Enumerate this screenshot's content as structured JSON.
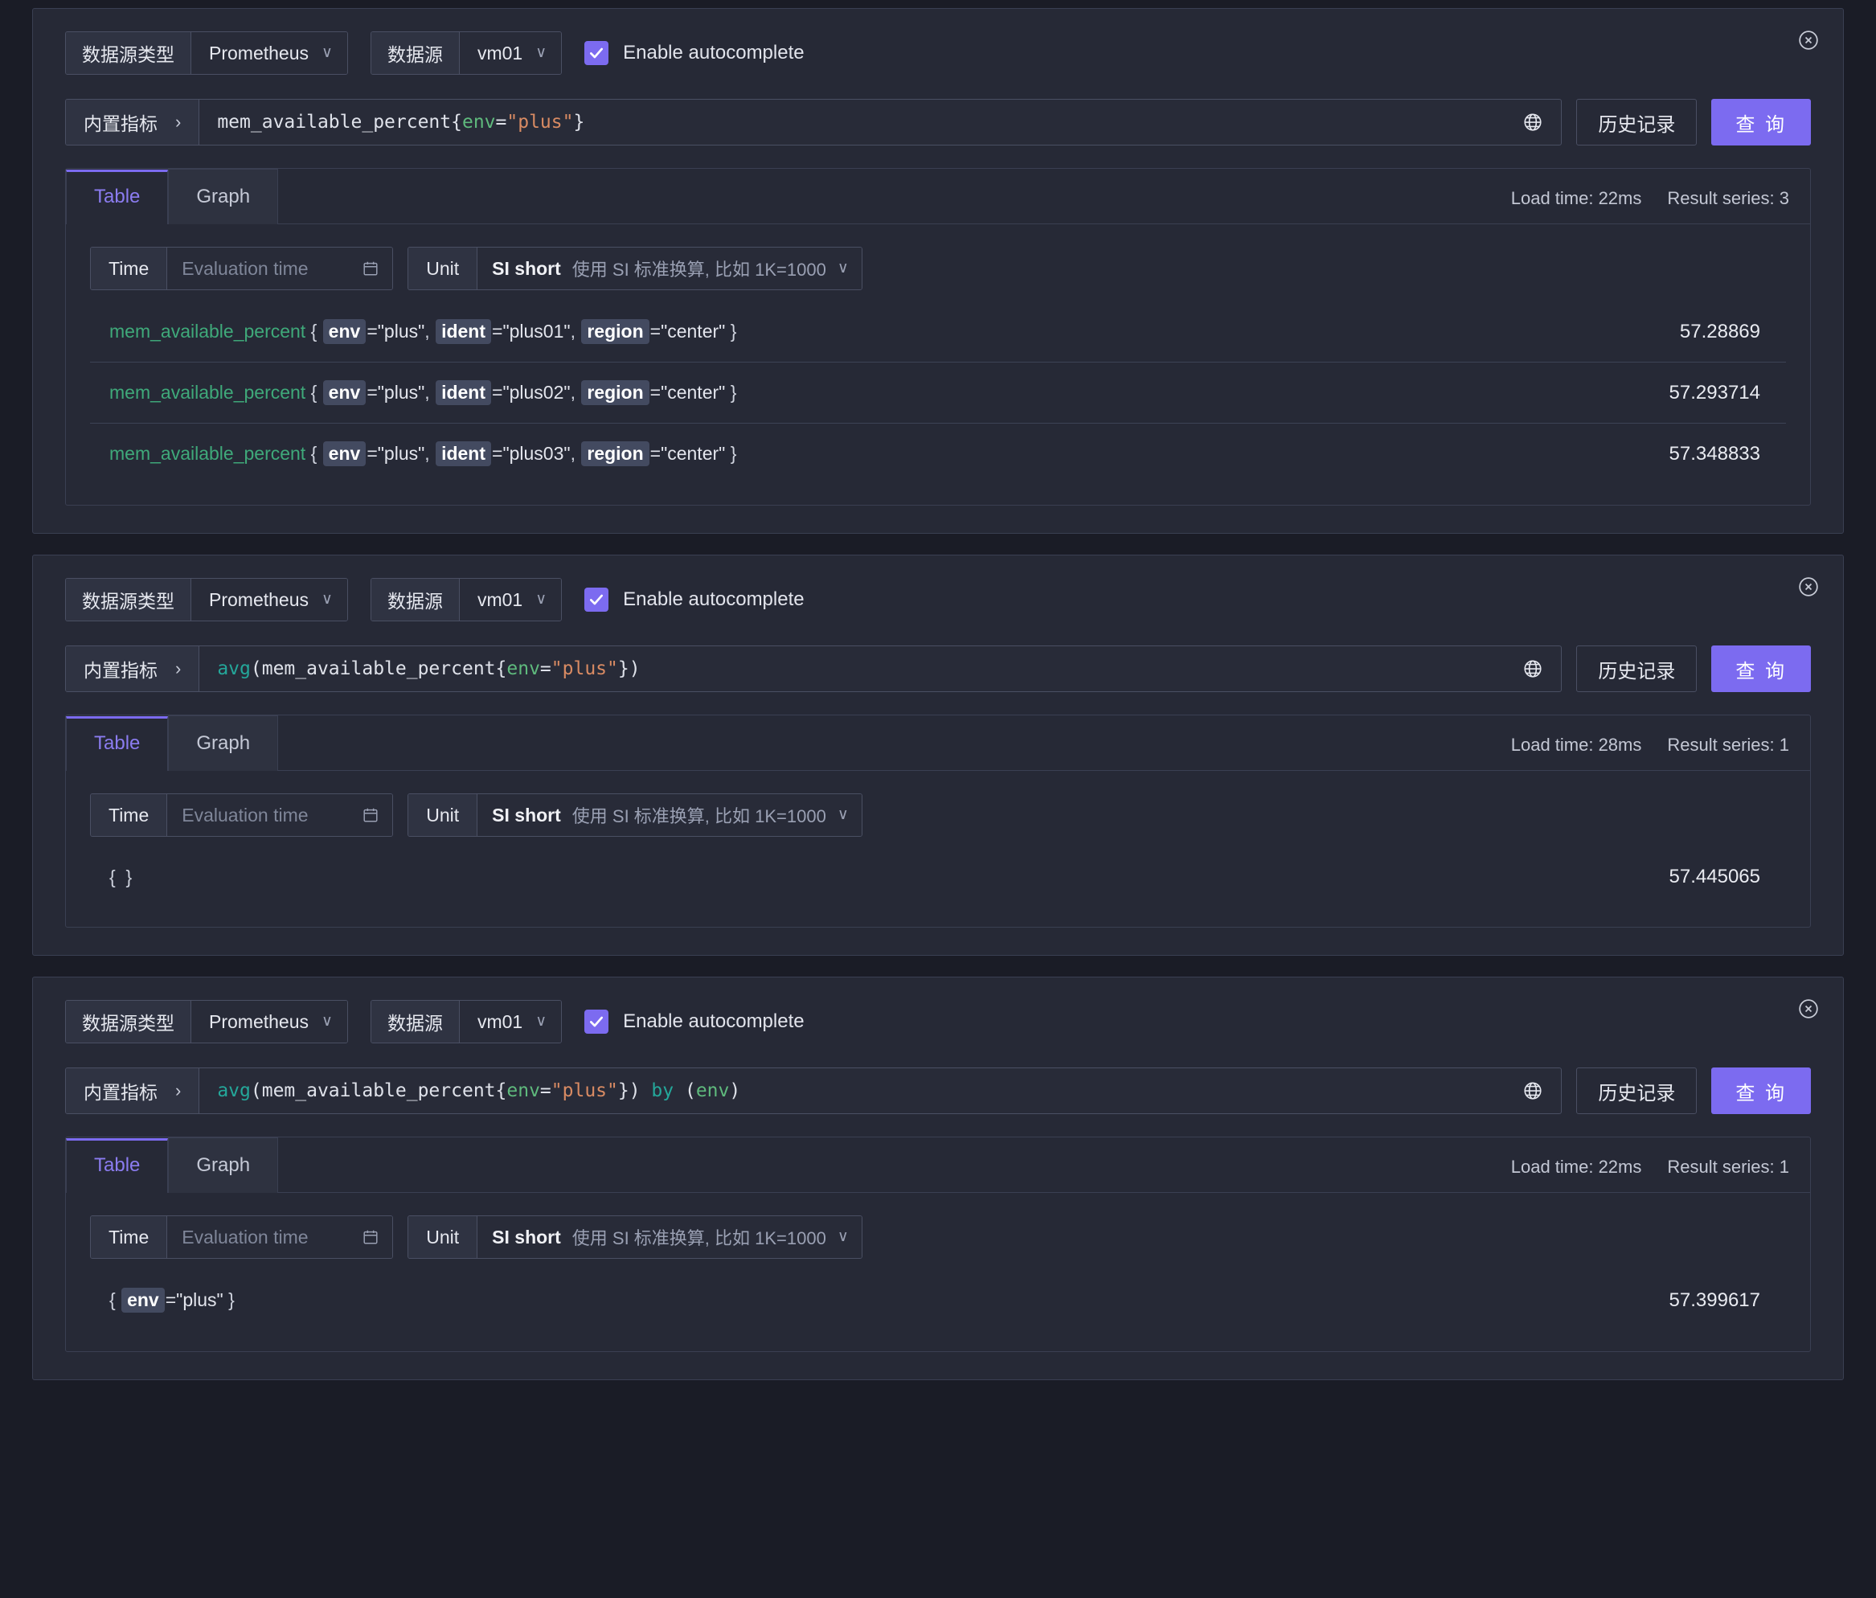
{
  "panels": [
    {
      "close_icon": "close-circle-icon",
      "datasource": {
        "type_label": "数据源类型",
        "type_value": "Prometheus",
        "ds_label": "数据源",
        "ds_value": "vm01",
        "autocomplete_label": "Enable autocomplete",
        "autocomplete_checked": true
      },
      "query": {
        "prefix_label": "内置指标",
        "prefix_chevron": "›",
        "globe_icon": "globe-icon",
        "history_label": "历史记录",
        "run_label": "查 询",
        "expression_tokens": [
          {
            "t": "plain",
            "v": "mem_available_percent{"
          },
          {
            "t": "label",
            "v": "env"
          },
          {
            "t": "plain",
            "v": "="
          },
          {
            "t": "str",
            "v": "\"plus\""
          },
          {
            "t": "plain",
            "v": "}"
          }
        ]
      },
      "tabs": [
        {
          "label": "Table",
          "active": true
        },
        {
          "label": "Graph",
          "active": false
        }
      ],
      "meta": {
        "load_time": "Load time: 22ms",
        "result_series": "Result series: 3"
      },
      "controls": {
        "time_label": "Time",
        "time_placeholder": "Evaluation time",
        "calendar_icon": "calendar-icon",
        "unit_label": "Unit",
        "unit_value": "SI short",
        "unit_desc": "使用 SI 标准换算, 比如 1K=1000",
        "unit_caret": "chevron-down-icon"
      },
      "rows": [
        {
          "metric": "mem_available_percent",
          "labels": [
            {
              "key": "env",
              "value": "\"plus\""
            },
            {
              "key": "ident",
              "value": "\"plus01\""
            },
            {
              "key": "region",
              "value": "\"center\""
            }
          ],
          "value": "57.28869"
        },
        {
          "metric": "mem_available_percent",
          "labels": [
            {
              "key": "env",
              "value": "\"plus\""
            },
            {
              "key": "ident",
              "value": "\"plus02\""
            },
            {
              "key": "region",
              "value": "\"center\""
            }
          ],
          "value": "57.293714"
        },
        {
          "metric": "mem_available_percent",
          "labels": [
            {
              "key": "env",
              "value": "\"plus\""
            },
            {
              "key": "ident",
              "value": "\"plus03\""
            },
            {
              "key": "region",
              "value": "\"center\""
            }
          ],
          "value": "57.348833"
        }
      ]
    },
    {
      "close_icon": "close-circle-icon",
      "datasource": {
        "type_label": "数据源类型",
        "type_value": "Prometheus",
        "ds_label": "数据源",
        "ds_value": "vm01",
        "autocomplete_label": "Enable autocomplete",
        "autocomplete_checked": true
      },
      "query": {
        "prefix_label": "内置指标",
        "prefix_chevron": "›",
        "globe_icon": "globe-icon",
        "history_label": "历史记录",
        "run_label": "查 询",
        "expression_tokens": [
          {
            "t": "fn",
            "v": "avg"
          },
          {
            "t": "plain",
            "v": "(mem_available_percent{"
          },
          {
            "t": "label",
            "v": "env"
          },
          {
            "t": "plain",
            "v": "="
          },
          {
            "t": "str",
            "v": "\"plus\""
          },
          {
            "t": "plain",
            "v": "})"
          }
        ]
      },
      "tabs": [
        {
          "label": "Table",
          "active": true
        },
        {
          "label": "Graph",
          "active": false
        }
      ],
      "meta": {
        "load_time": "Load time: 28ms",
        "result_series": "Result series: 1"
      },
      "controls": {
        "time_label": "Time",
        "time_placeholder": "Evaluation time",
        "calendar_icon": "calendar-icon",
        "unit_label": "Unit",
        "unit_value": "SI short",
        "unit_desc": "使用 SI 标准换算, 比如 1K=1000",
        "unit_caret": "chevron-down-icon"
      },
      "rows": [
        {
          "metric": "",
          "labels": [],
          "value": "57.445065"
        }
      ]
    },
    {
      "close_icon": "close-circle-icon",
      "datasource": {
        "type_label": "数据源类型",
        "type_value": "Prometheus",
        "ds_label": "数据源",
        "ds_value": "vm01",
        "autocomplete_label": "Enable autocomplete",
        "autocomplete_checked": true
      },
      "query": {
        "prefix_label": "内置指标",
        "prefix_chevron": "›",
        "globe_icon": "globe-icon",
        "history_label": "历史记录",
        "run_label": "查 询",
        "expression_tokens": [
          {
            "t": "fn",
            "v": "avg"
          },
          {
            "t": "plain",
            "v": "(mem_available_percent{"
          },
          {
            "t": "label",
            "v": "env"
          },
          {
            "t": "plain",
            "v": "="
          },
          {
            "t": "str",
            "v": "\"plus\""
          },
          {
            "t": "plain",
            "v": "}) "
          },
          {
            "t": "fn",
            "v": "by"
          },
          {
            "t": "plain",
            "v": " ("
          },
          {
            "t": "label",
            "v": "env"
          },
          {
            "t": "plain",
            "v": ")"
          }
        ]
      },
      "tabs": [
        {
          "label": "Table",
          "active": true
        },
        {
          "label": "Graph",
          "active": false
        }
      ],
      "meta": {
        "load_time": "Load time: 22ms",
        "result_series": "Result series: 1"
      },
      "controls": {
        "time_label": "Time",
        "time_placeholder": "Evaluation time",
        "calendar_icon": "calendar-icon",
        "unit_label": "Unit",
        "unit_value": "SI short",
        "unit_desc": "使用 SI 标准换算, 比如 1K=1000",
        "unit_caret": "chevron-down-icon"
      },
      "rows": [
        {
          "metric": "",
          "labels": [
            {
              "key": "env",
              "value": "\"plus\""
            }
          ],
          "value": "57.399617"
        }
      ]
    }
  ],
  "colors": {
    "accent": "#7c6bf0",
    "background": "#1a1c26",
    "panel": "#262936",
    "metric": "#3fa97a",
    "string": "#d98b63",
    "func": "#24a79a"
  }
}
